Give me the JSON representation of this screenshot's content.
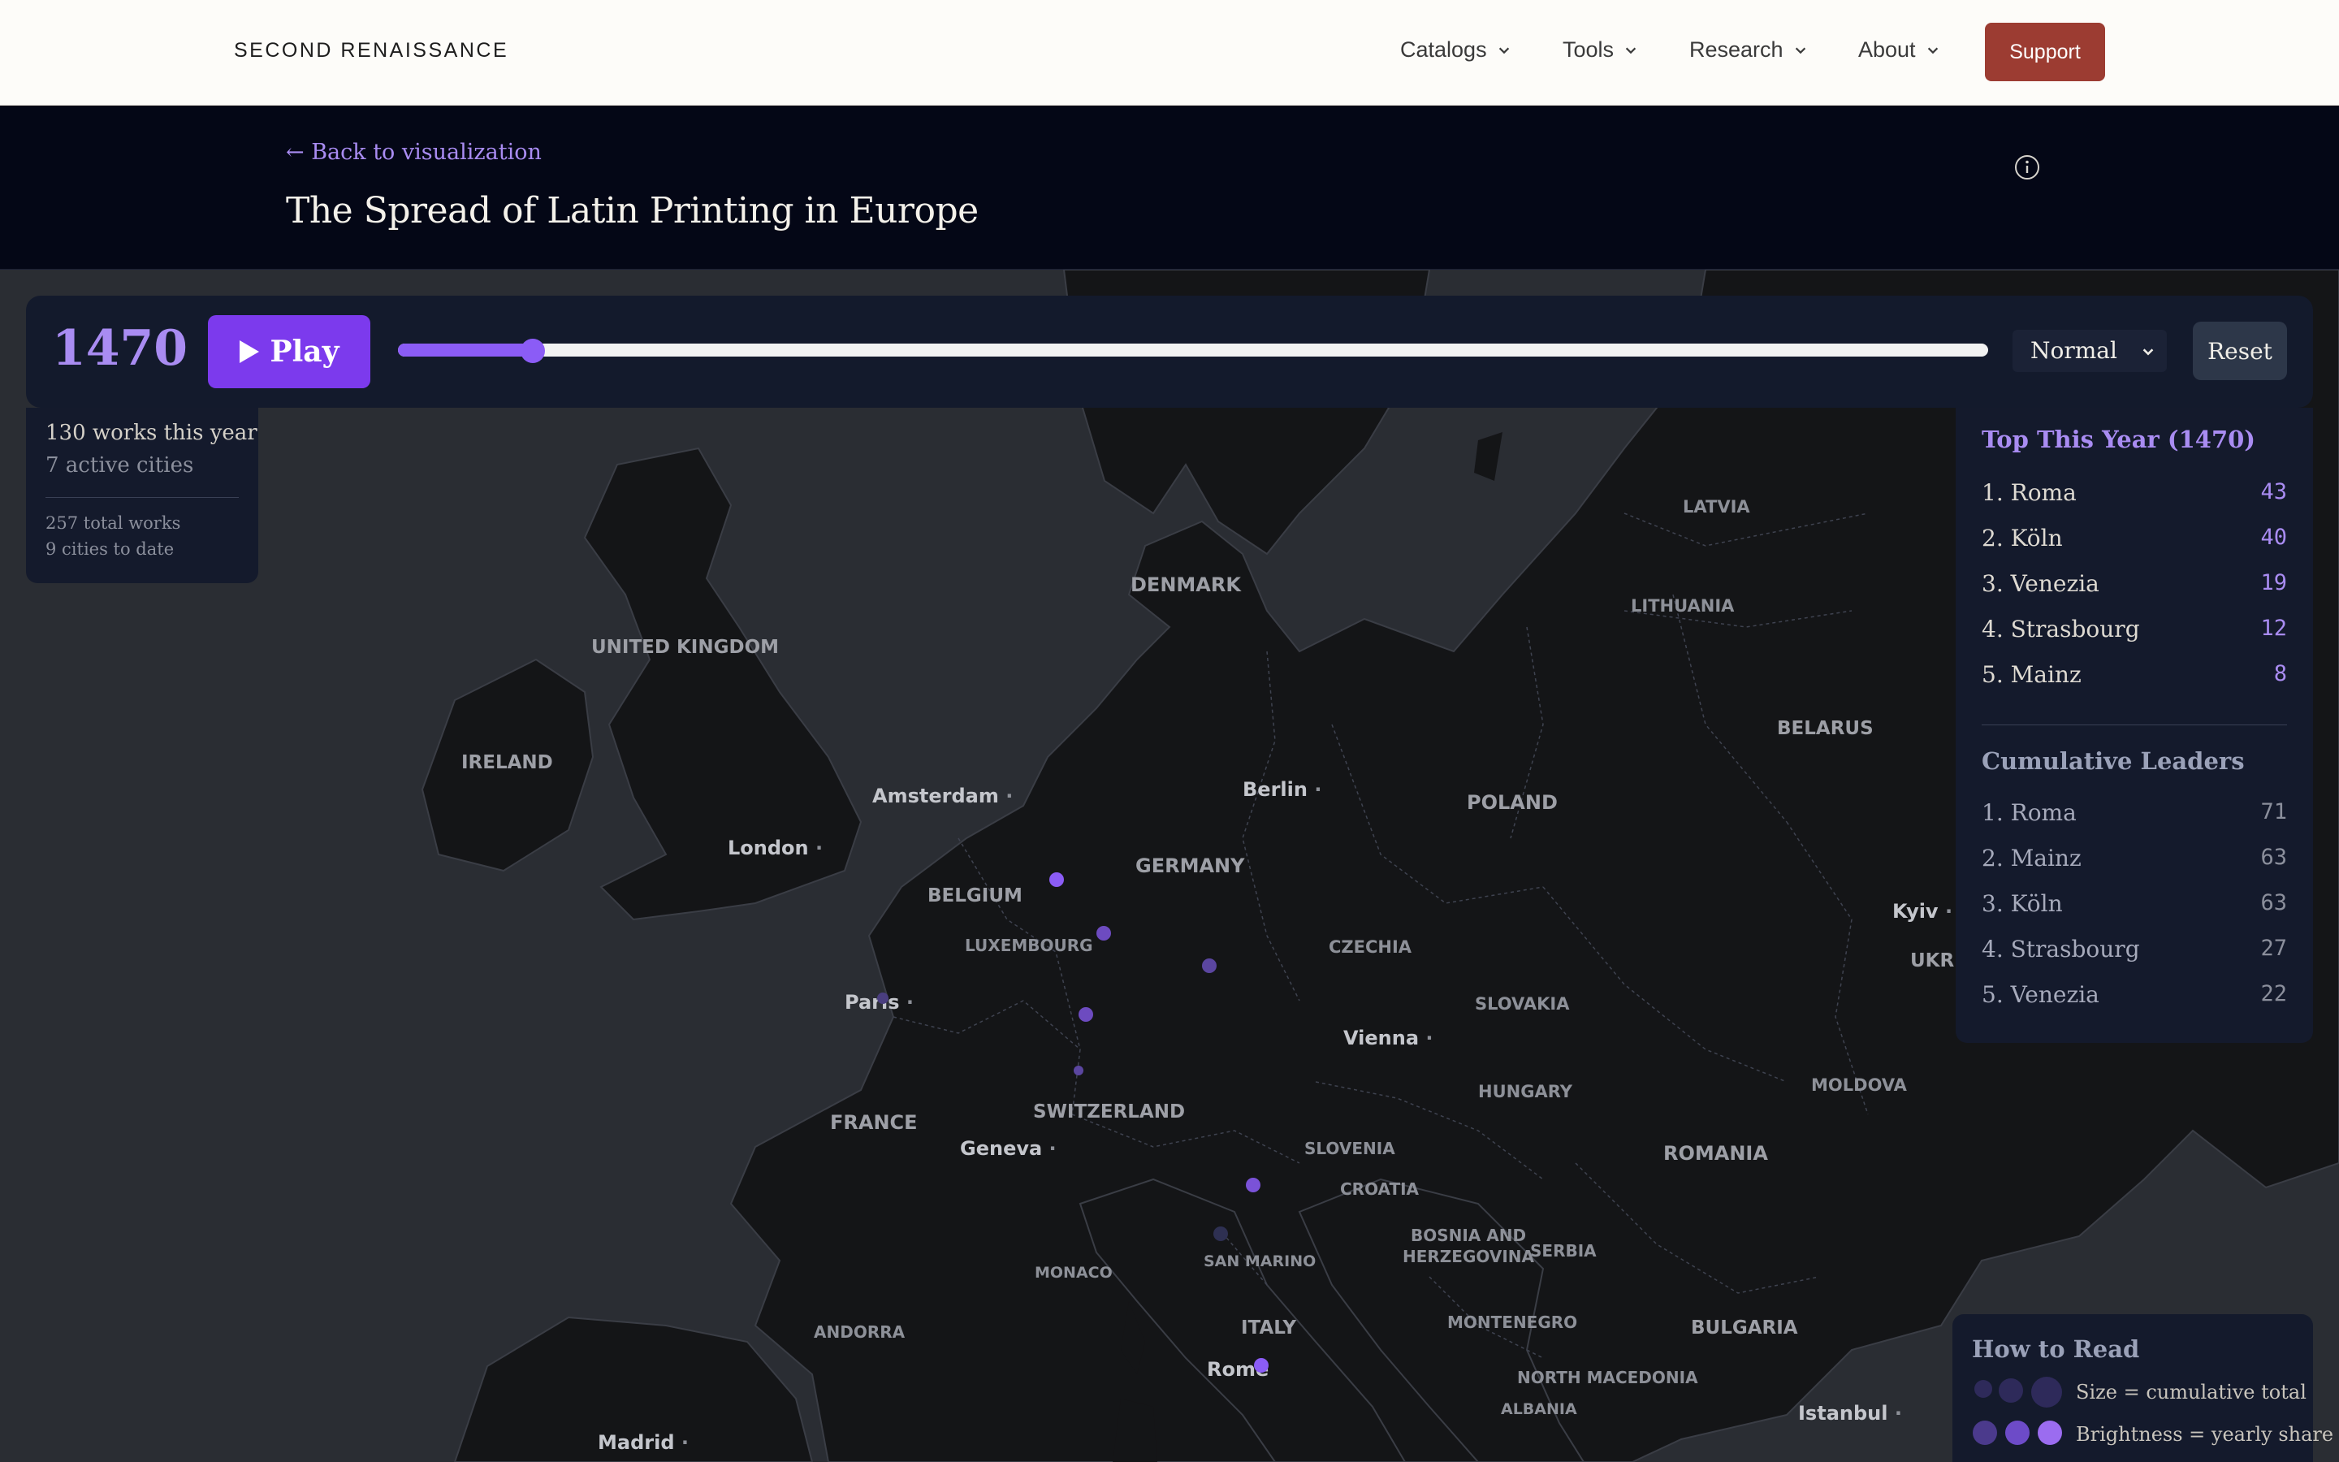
{
  "nav": {
    "brand": "SECOND RENAISSANCE",
    "items": [
      {
        "label": "Catalogs"
      },
      {
        "label": "Tools"
      },
      {
        "label": "Research"
      },
      {
        "label": "About"
      }
    ],
    "support_label": "Support"
  },
  "header": {
    "back_label": "← Back to visualization",
    "title": "The Spread of Latin Printing in Europe",
    "info_icon": "info-circle-icon"
  },
  "controls": {
    "year": "1470",
    "play_label": "Play",
    "timeline": {
      "start_year": 1450,
      "end_year": 1650,
      "current_year": 1470,
      "fill_fraction": 0.085
    },
    "speed": {
      "selected": "Normal"
    },
    "reset_label": "Reset"
  },
  "stats": {
    "works_this_year": "130 works this year",
    "active_cities": "7 active cities",
    "total_works": "257 total works",
    "cities_to_date": "9 cities to date"
  },
  "leaderboard": {
    "top_title": "Top This Year (1470)",
    "top": [
      {
        "name": "1. Roma",
        "count": "43"
      },
      {
        "name": "2. Köln",
        "count": "40"
      },
      {
        "name": "3. Venezia",
        "count": "19"
      },
      {
        "name": "4. Strasbourg",
        "count": "12"
      },
      {
        "name": "5. Mainz",
        "count": "8"
      }
    ],
    "cum_title": "Cumulative Leaders",
    "cumulative": [
      {
        "name": "1. Roma",
        "count": "71"
      },
      {
        "name": "2. Mainz",
        "count": "63"
      },
      {
        "name": "3. Köln",
        "count": "63"
      },
      {
        "name": "4. Strasbourg",
        "count": "27"
      },
      {
        "name": "5. Venezia",
        "count": "22"
      }
    ]
  },
  "legend": {
    "title": "How to Read",
    "size_text": "Size = cumulative total",
    "brightness_text": "Brightness = yearly share"
  },
  "map": {
    "countries": [
      "LATVIA",
      "LITHUANIA",
      "DENMARK",
      "UNITED KINGDOM",
      "IRELAND",
      "BELARUS",
      "POLAND",
      "GERMANY",
      "BELGIUM",
      "LUXEMBOURG",
      "CZECHIA",
      "SLOVAKIA",
      "FRANCE",
      "SWITZERLAND",
      "HUNGARY",
      "MOLDOVA",
      "SLOVENIA",
      "CROATIA",
      "ROMANIA",
      "BOSNIA AND HERZEGOVINA",
      "SERBIA",
      "MONACO",
      "SAN MARINO",
      "ANDORRA",
      "ITALY",
      "MONTENEGRO",
      "BULGARIA",
      "NORTH MACEDONIA",
      "ALBANIA",
      "UKR"
    ],
    "cities": [
      "Amsterdam",
      "Berlin",
      "London",
      "Kyiv",
      "Paris",
      "Vienna",
      "Geneva",
      "Rome",
      "Istanbul",
      "Madrid"
    ],
    "colors": {
      "land": "#141517",
      "sea": "#2a2d33",
      "marker": "#8b5cf6",
      "accent": "#a98cf2"
    }
  }
}
